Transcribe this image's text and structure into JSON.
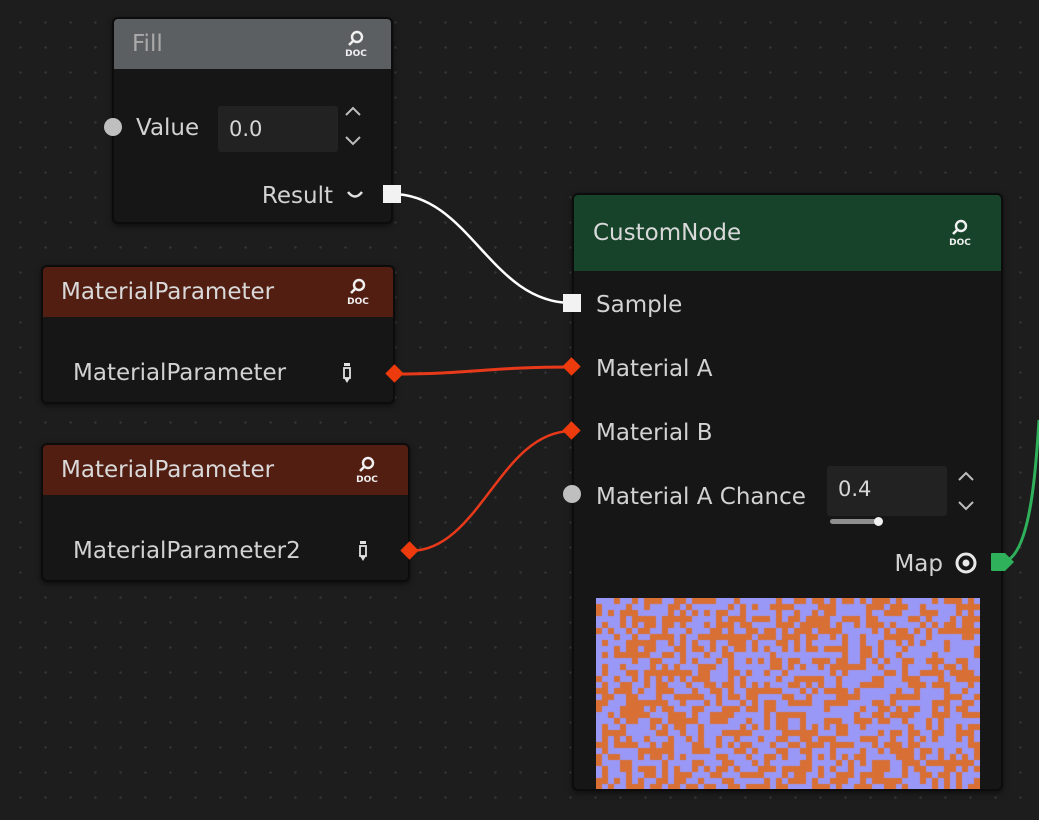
{
  "fill_node": {
    "title": "Fill",
    "value_label": "Value",
    "value": "0.0",
    "result_label": "Result"
  },
  "material_param_1": {
    "title": "MaterialParameter",
    "output_label": "MaterialParameter"
  },
  "material_param_2": {
    "title": "MaterialParameter",
    "output_label": "MaterialParameter2"
  },
  "custom_node": {
    "title": "CustomNode",
    "sample_label": "Sample",
    "material_a_label": "Material A",
    "material_b_label": "Material B",
    "chance_label": "Material A Chance",
    "chance_value": "0.4",
    "chance_fraction": 0.4,
    "map_label": "Map"
  },
  "icons": {
    "doc": "doc-search-icon",
    "pin": "pin-icon",
    "eye": "eye-icon",
    "collapse": "chevron-down-icon",
    "spinner": "spinner-arrows-icon"
  },
  "colors": {
    "fill_header": "#5c5f62",
    "material_header": "#521e12",
    "custom_header": "#16432a",
    "material_wire": "#e8391a",
    "sample_wire": "#ffffff",
    "map_wire": "#2fb05a",
    "preview_a": "#9a98f6",
    "preview_b": "#d86f34"
  }
}
